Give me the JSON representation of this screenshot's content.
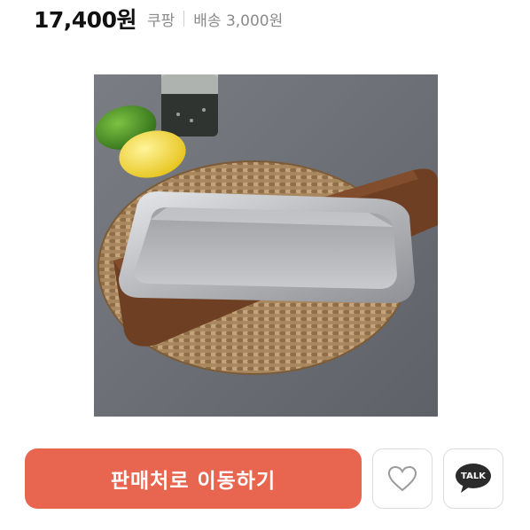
{
  "product": {
    "price": "17,400원",
    "seller": "쿠팡",
    "shipping": "배송 3,000원"
  },
  "image": {
    "subject": "stainless steel rectangular tray on wooden board and woven rattan mat with lemon, lime and pepper jar",
    "zoom_icon": "plus-icon"
  },
  "actions": {
    "buy_label": "판매처로 이동하기",
    "buy_color": "#e8664f",
    "like_icon": "heart-icon",
    "talk_label": "TALK"
  }
}
